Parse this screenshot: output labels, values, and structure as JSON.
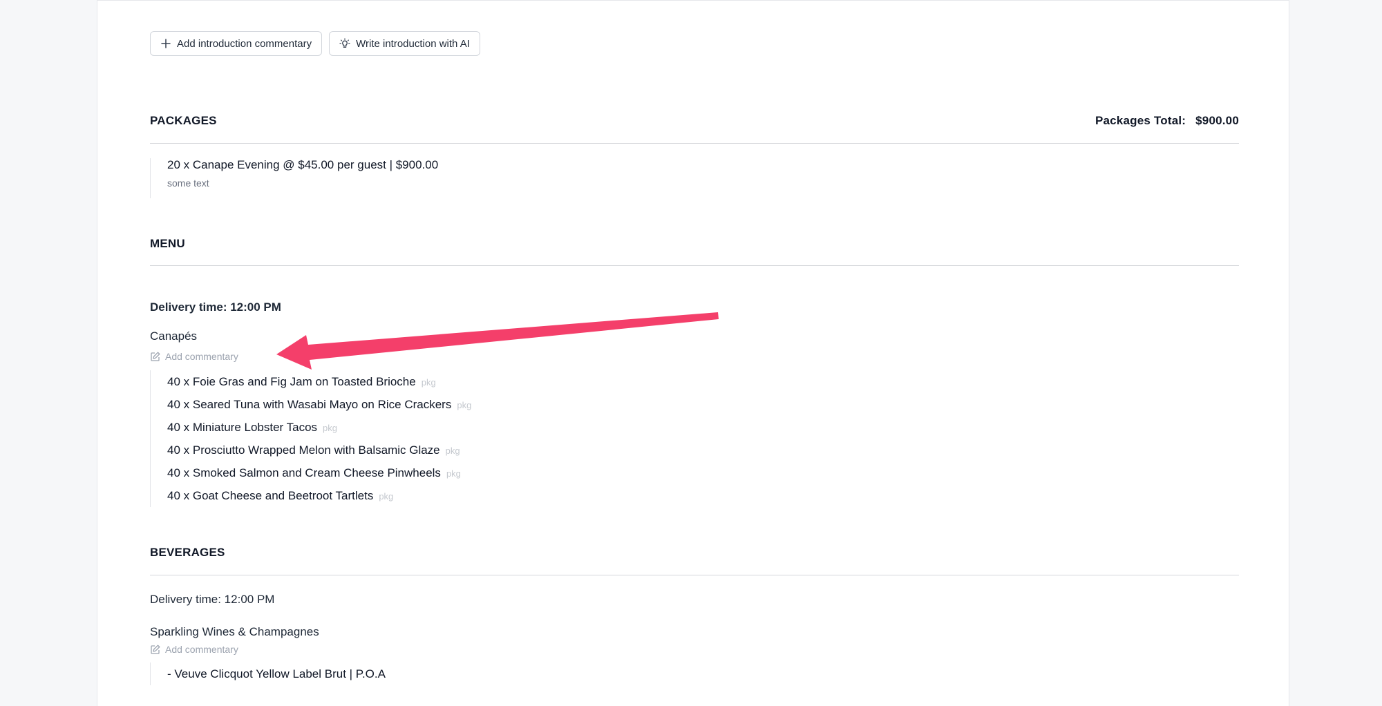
{
  "toolbar": {
    "add_intro_label": "Add introduction commentary",
    "ai_intro_label": "Write introduction with AI"
  },
  "packages": {
    "heading": "PACKAGES",
    "total_label": "Packages Total:",
    "total_value": "$900.00",
    "line": "20 x Canape Evening @ $45.00 per guest | $900.00",
    "note": "some text"
  },
  "menu": {
    "heading": "MENU",
    "delivery": "Delivery time: 12:00 PM",
    "category": "Canapés",
    "add_commentary": "Add commentary",
    "items": [
      {
        "text": "40 x Foie Gras and Fig Jam on Toasted Brioche",
        "tag": "pkg"
      },
      {
        "text": "40 x Seared Tuna with Wasabi Mayo on Rice Crackers",
        "tag": "pkg"
      },
      {
        "text": "40 x Miniature Lobster Tacos",
        "tag": "pkg"
      },
      {
        "text": "40 x Prosciutto Wrapped Melon with Balsamic Glaze",
        "tag": "pkg"
      },
      {
        "text": "40 x Smoked Salmon and Cream Cheese Pinwheels",
        "tag": "pkg"
      },
      {
        "text": "40 x Goat Cheese and Beetroot Tartlets",
        "tag": "pkg"
      }
    ]
  },
  "beverages": {
    "heading": "BEVERAGES",
    "delivery": "Delivery time: 12:00 PM",
    "category": "Sparkling Wines & Champagnes",
    "add_commentary": "Add commentary",
    "items": [
      {
        "text": "- Veuve Clicquot Yellow Label Brut | P.O.A"
      }
    ]
  },
  "colors": {
    "annotation_arrow": "#f43f6a"
  }
}
